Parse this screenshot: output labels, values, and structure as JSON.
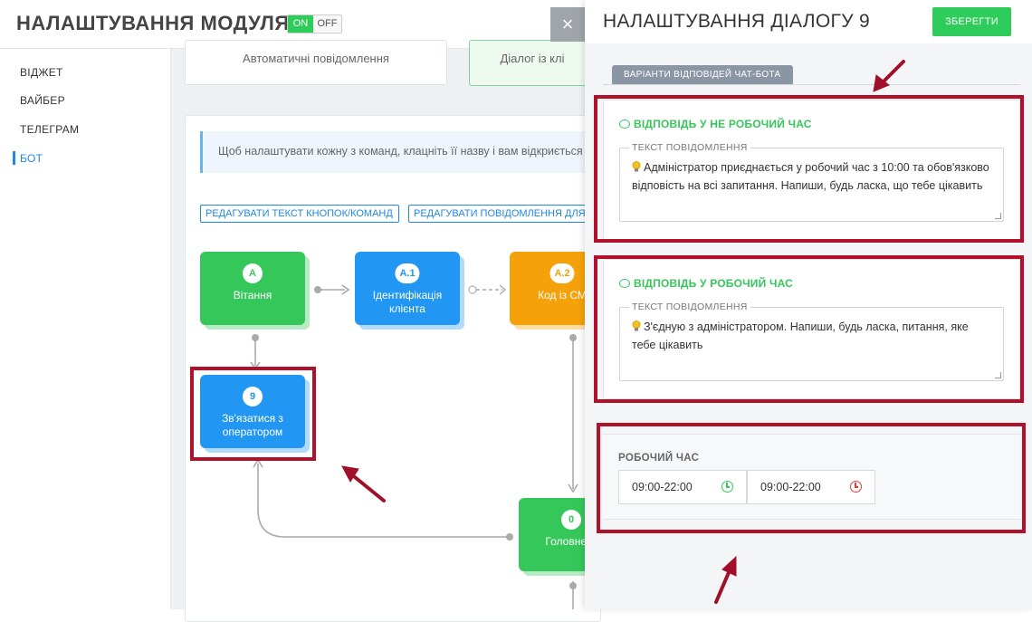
{
  "module": {
    "title": "НАЛАШТУВАННЯ МОДУЛЯ",
    "toggle_on": "ON",
    "toggle_off": "OFF"
  },
  "sidebar": {
    "items": [
      {
        "label": "ВІДЖЕТ"
      },
      {
        "label": "ВАЙБЕР"
      },
      {
        "label": "ТЕЛЕГРАМ"
      },
      {
        "label": "БОТ"
      }
    ]
  },
  "tabs": {
    "auto": "Автоматичні повідомлення",
    "dialog": "Діалог із клі"
  },
  "info_text": "Щоб налаштувати кожну з команд, клацніть її назву і вам відкриється",
  "buttons": {
    "edit_buttons": "РЕДАГУВАТИ ТЕКСТ КНОПОК/КОМАНД",
    "edit_messages": "РЕДАГУВАТИ ПОВІДОМЛЕННЯ ДЛЯ"
  },
  "nodes": [
    {
      "badge": "A",
      "label": "Вітання"
    },
    {
      "badge": "A.1",
      "label": "Ідентифікація клієнта"
    },
    {
      "badge": "A.2",
      "label": "Код із СМ"
    },
    {
      "badge": "9",
      "label": "Зв'язатися з оператором"
    },
    {
      "badge": "0",
      "label": "Головне м"
    }
  ],
  "close_label": "×",
  "panel": {
    "title": "НАЛАШТУВАННЯ ДІАЛОГУ 9",
    "save": "ЗБЕРЕГТИ",
    "tab": "ВАРІАНТИ ВІДПОВІДЕЙ ЧАТ-БОТА",
    "offhours": {
      "title": "ВІДПОВІДЬ У НЕ РОБОЧИЙ ЧАС",
      "field_label": "ТЕКСТ ПОВІДОМЛЕННЯ",
      "text": "Адміністратор приєднається у робочий час з 10:00 та обов'язково відповість на всі запитання. Напиши, будь ласка, що тебе цікавить"
    },
    "workhours": {
      "title": "ВІДПОВІДЬ У РОБОЧИЙ ЧАС",
      "field_label": "ТЕКСТ ПОВІДОМЛЕННЯ",
      "text": "З'єдную з адміністратором. Напиши, будь ласка, питання, яке тебе цікавить"
    },
    "schedule": {
      "title": "РОБОЧИЙ ЧАС",
      "start": "09:00-22:00",
      "end": "09:00-22:00"
    }
  },
  "colors": {
    "green": "#35c75a",
    "blue": "#2196f3",
    "orange": "#f5a10a",
    "highlight": "#b1102a",
    "clock_start": "#35c75a",
    "clock_end": "#e53935"
  },
  "icons": [
    "chat-icon",
    "lightbulb-icon",
    "clock-icon",
    "close-icon"
  ]
}
